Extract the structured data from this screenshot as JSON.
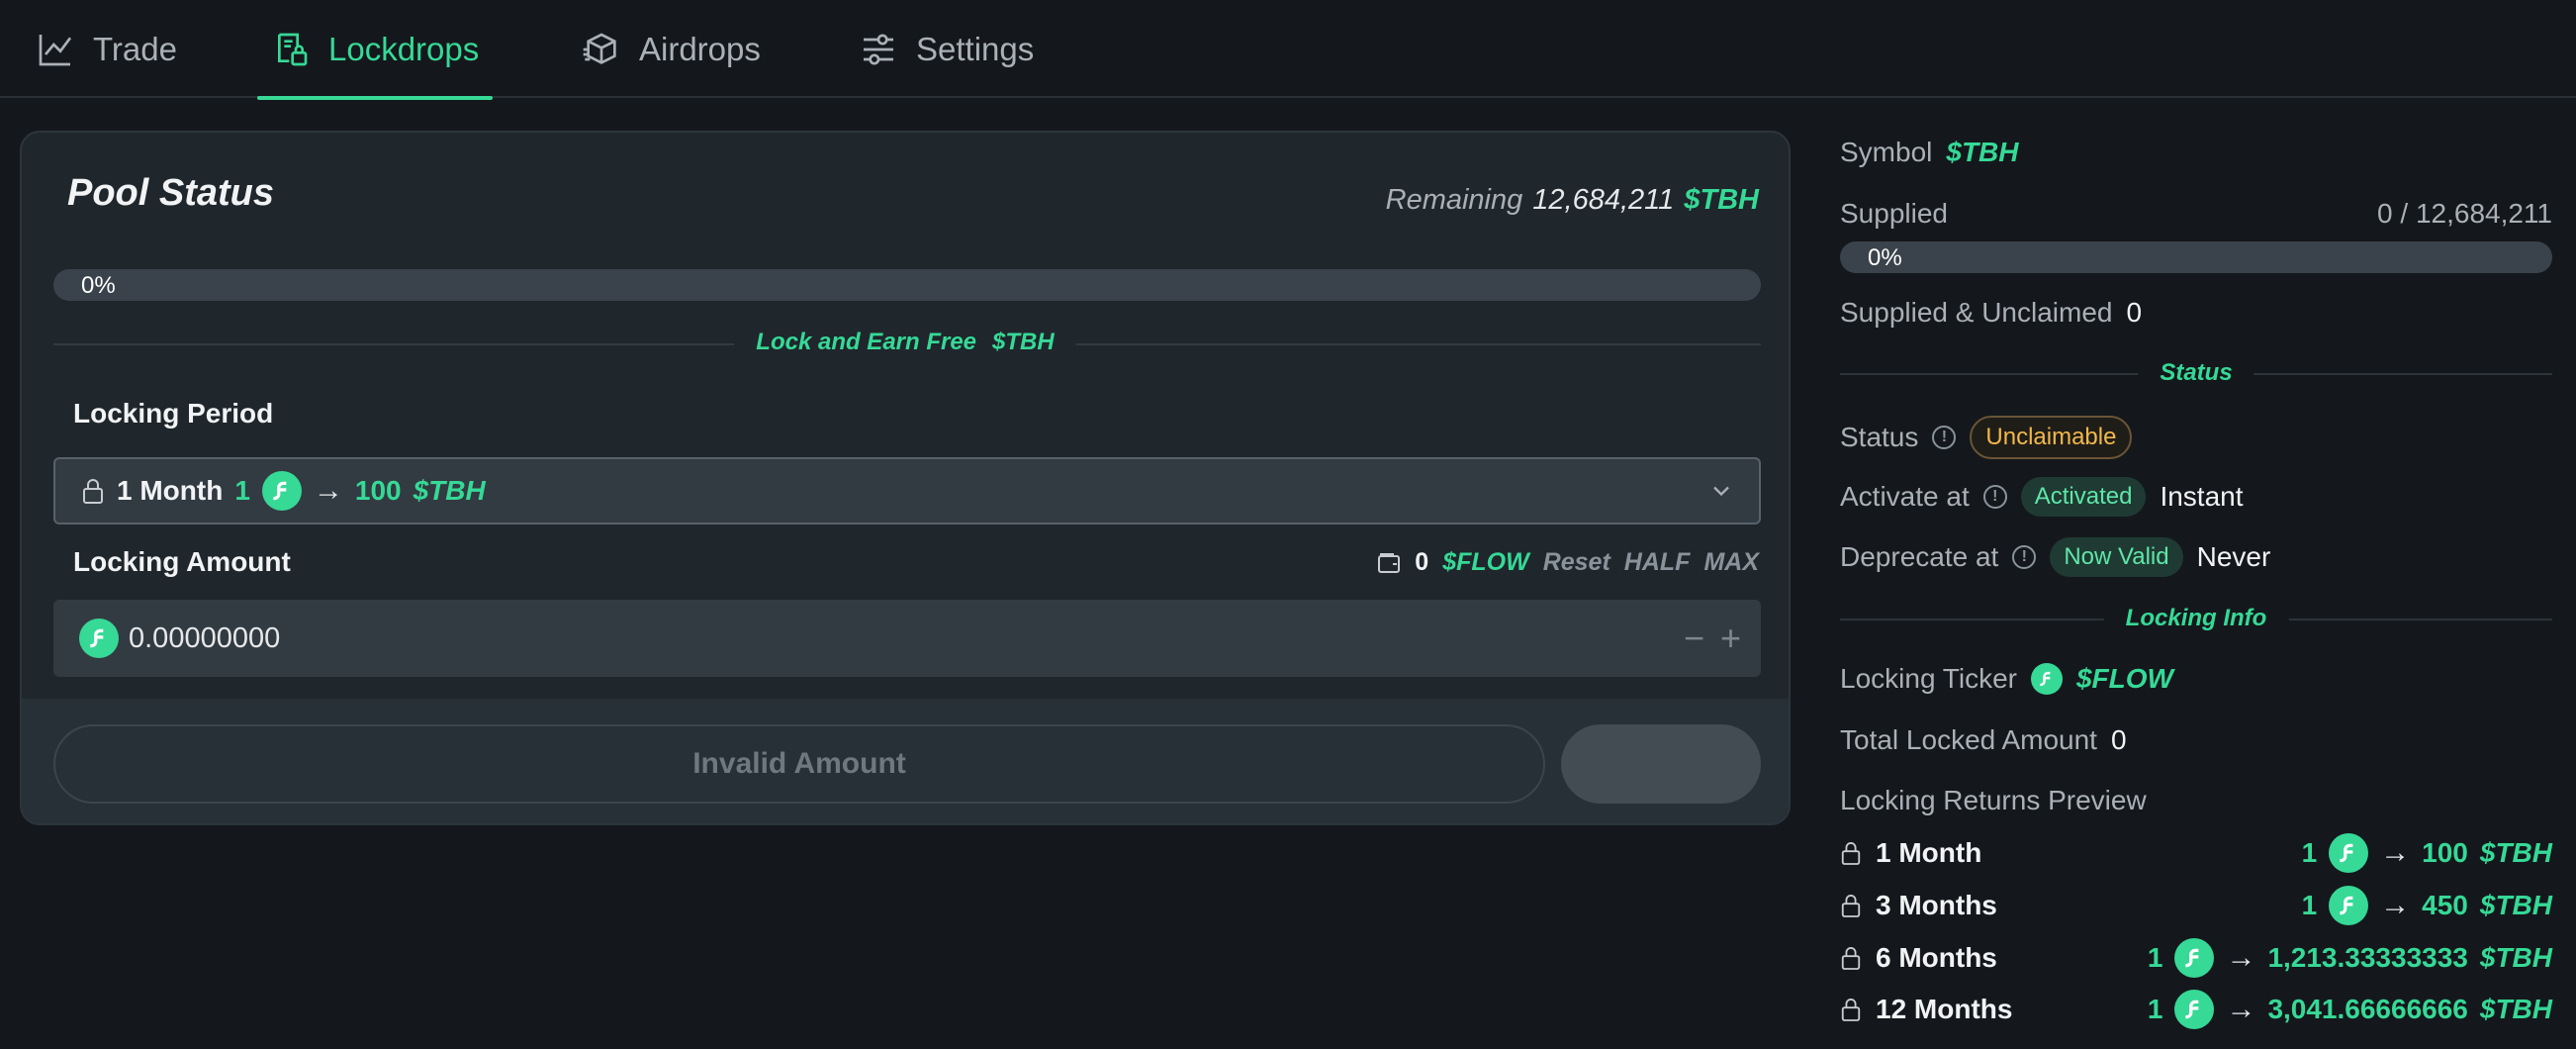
{
  "nav": {
    "tabs": [
      {
        "label": "Trade",
        "icon": "chart-icon"
      },
      {
        "label": "Lockdrops",
        "icon": "lockdrop-icon",
        "active": true
      },
      {
        "label": "Airdrops",
        "icon": "airdrop-icon"
      },
      {
        "label": "Settings",
        "icon": "sliders-icon"
      }
    ]
  },
  "pool": {
    "title": "Pool Status",
    "remaining_label": "Remaining",
    "remaining_value": "12,684,211",
    "ticker": "$TBH",
    "progress_text": "0%",
    "progress": 0,
    "lock_earn_label": "Lock and Earn Free",
    "period_label": "Locking Period",
    "period_selected": {
      "label": "1 Month",
      "in_amount": "1",
      "out_amount": "100",
      "out_ticker": "$TBH"
    },
    "amount_label": "Locking Amount",
    "balance": "0",
    "balance_ticker": "$FLOW",
    "reset": "Reset",
    "half": "HALF",
    "max": "MAX",
    "amount_value": "0.00000000",
    "minus": "−",
    "plus": "+",
    "submit_label": "Invalid Amount"
  },
  "side": {
    "symbol_label": "Symbol",
    "symbol_value": "$TBH",
    "supplied_label": "Supplied",
    "supplied_value": "0 / 12,684,211",
    "supplied_progress_text": "0%",
    "supplied_progress": 0,
    "unclaimed_label": "Supplied & Unclaimed",
    "unclaimed_value": "0",
    "status_section": "Status",
    "status_label": "Status",
    "status_value": "Unclaimable",
    "activate_label": "Activate at",
    "activate_badge": "Activated",
    "activate_value": "Instant",
    "deprecate_label": "Deprecate at",
    "deprecate_badge": "Now Valid",
    "deprecate_value": "Never",
    "locking_section": "Locking Info",
    "ticker_label": "Locking Ticker",
    "ticker_value": "$FLOW",
    "total_label": "Total Locked Amount",
    "total_value": "0",
    "preview_label": "Locking Returns Preview",
    "returns": [
      {
        "period": "1 Month",
        "in": "1",
        "out": "100",
        "ticker": "$TBH"
      },
      {
        "period": "3 Months",
        "in": "1",
        "out": "450",
        "ticker": "$TBH"
      },
      {
        "period": "6 Months",
        "in": "1",
        "out": "1,213.33333333",
        "ticker": "$TBH"
      },
      {
        "period": "12 Months",
        "in": "1",
        "out": "3,041.66666666",
        "ticker": "$TBH"
      }
    ]
  },
  "colors": {
    "accent": "#36d996",
    "background": "#14181c",
    "panel": "#1f262c",
    "warning": "#f2b84b"
  }
}
